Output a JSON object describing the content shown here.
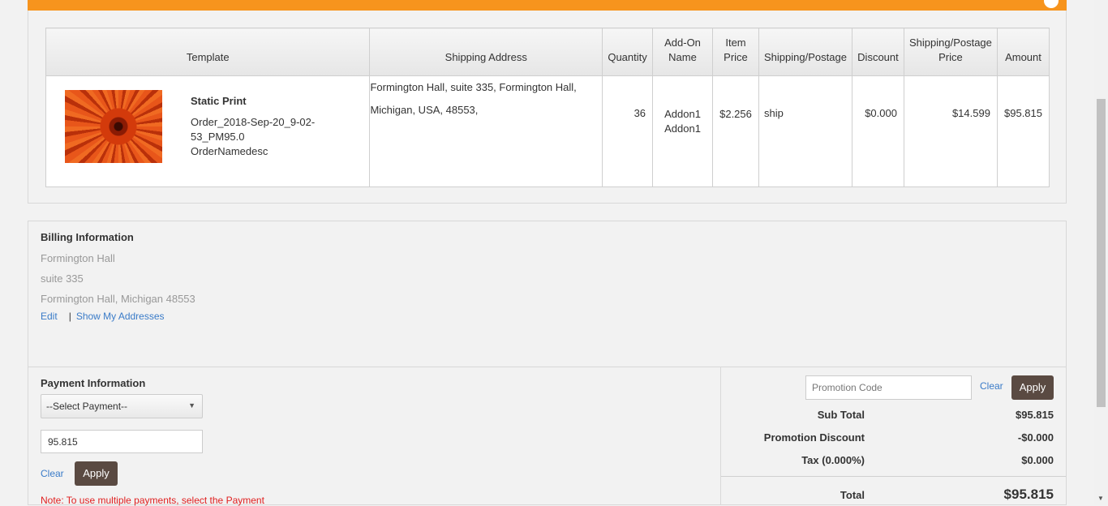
{
  "colors": {
    "accent": "#f7941d",
    "button": "#5a4a42",
    "link": "#3a7bc8",
    "note": "#e02020"
  },
  "order_table": {
    "headers": {
      "template": "Template",
      "shipping_address": "Shipping Address",
      "quantity": "Quantity",
      "addon_name": "Add-On Name",
      "item_price": "Item Price",
      "shipping_postage": "Shipping/Postage",
      "discount": "Discount",
      "shipping_postage_price": "Shipping/Postage Price",
      "amount": "Amount"
    },
    "row": {
      "template_title": "Static Print",
      "template_order": "Order_2018-Sep-20_9-02-53_PM95.0",
      "template_desc": "OrderNamedesc",
      "address_line1": "Formington Hall, suite 335, Formington Hall,",
      "address_line2": "Michigan, USA, 48553,",
      "quantity": "36",
      "addon1": "Addon1",
      "addon2": "Addon1",
      "item_price": "$2.256",
      "shipping_postage": "ship",
      "discount": "$0.000",
      "shipping_postage_price": "$14.599",
      "amount": "$95.815"
    }
  },
  "billing": {
    "title": "Billing Information",
    "line1": "Formington Hall",
    "line2": "suite 335",
    "line3": "Formington Hall, Michigan 48553",
    "edit_link": "Edit",
    "separator": "|",
    "show_addresses_link": "Show My Addresses"
  },
  "payment": {
    "title": "Payment Information",
    "select_value": "--Select Payment--",
    "amount_value": "95.815",
    "clear_label": "Clear",
    "apply_label": "Apply",
    "note": "Note: To use multiple payments, select the Payment"
  },
  "summary": {
    "promo_placeholder": "Promotion Code",
    "clear_label": "Clear",
    "apply_label": "Apply",
    "subtotal_label": "Sub Total",
    "subtotal_value": "$95.815",
    "promo_discount_label": "Promotion Discount",
    "promo_discount_value": "-$0.000",
    "tax_label": "Tax (0.000%)",
    "tax_value": "$0.000",
    "total_label": "Total",
    "total_value": "$95.815"
  }
}
